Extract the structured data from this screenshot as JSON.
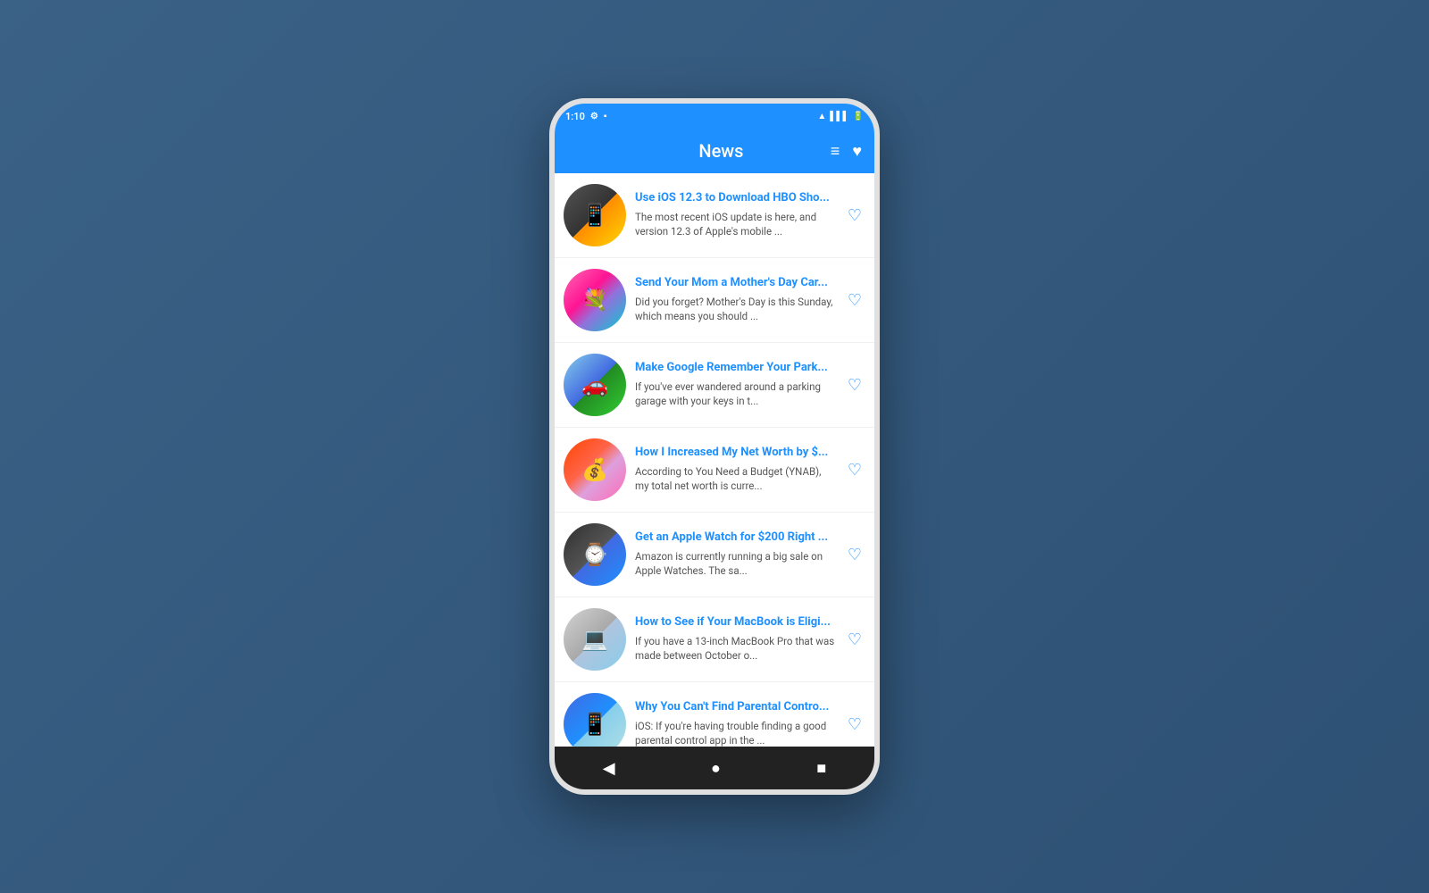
{
  "status_bar": {
    "time": "1:10",
    "settings_icon": "⚙",
    "battery_icon": "▪",
    "wifi_icon": "▲",
    "signal_icon": "▌"
  },
  "app_bar": {
    "title": "News",
    "filter_icon": "≡",
    "heart_icon": "♥"
  },
  "news_items": [
    {
      "id": 1,
      "thumb_class": "thumb-1",
      "thumb_emoji": "📱",
      "title": "Use iOS 12.3 to Download HBO Sho...",
      "excerpt": "The most recent iOS update is here, and version 12.3 of Apple's mobile ..."
    },
    {
      "id": 2,
      "thumb_class": "thumb-2",
      "thumb_emoji": "💐",
      "title": "Send Your Mom a Mother's Day Car...",
      "excerpt": "Did you forget? Mother's Day is this Sunday, which means you should ..."
    },
    {
      "id": 3,
      "thumb_class": "thumb-3",
      "thumb_emoji": "🚗",
      "title": "Make Google Remember Your Park...",
      "excerpt": "If you've ever wandered around a parking garage with your keys in t..."
    },
    {
      "id": 4,
      "thumb_class": "thumb-4",
      "thumb_emoji": "💰",
      "title": "How I Increased My Net Worth by $...",
      "excerpt": "According to You Need a Budget (YNAB), my total net worth is curre..."
    },
    {
      "id": 5,
      "thumb_class": "thumb-5",
      "thumb_emoji": "⌚",
      "title": "Get an Apple Watch for $200 Right ...",
      "excerpt": "Amazon is currently running a big sale on Apple Watches. The sa..."
    },
    {
      "id": 6,
      "thumb_class": "thumb-6",
      "thumb_emoji": "💻",
      "title": "How to See if Your MacBook is Eligi...",
      "excerpt": "If you have a 13-inch MacBook Pro that was made between October o..."
    },
    {
      "id": 7,
      "thumb_class": "thumb-7",
      "thumb_emoji": "📱",
      "title": "Why You Can't Find Parental Contro...",
      "excerpt": "iOS: If you're having trouble finding a good parental control app in the ..."
    }
  ],
  "bottom_nav": {
    "back_icon": "◀",
    "home_icon": "●",
    "square_icon": "■"
  }
}
